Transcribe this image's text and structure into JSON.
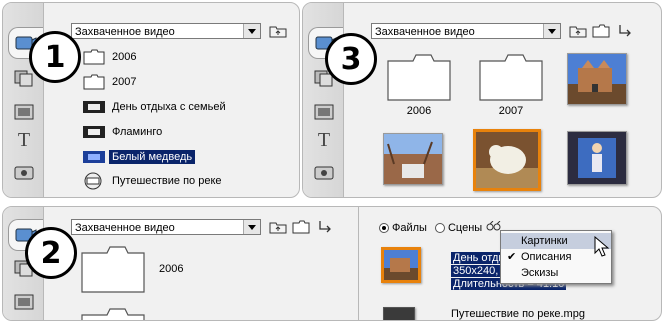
{
  "combo_label": "Захваченное видео",
  "panel1": {
    "badge": "1",
    "items": [
      {
        "label": "2006",
        "icon": "folder-icon"
      },
      {
        "label": "2007",
        "icon": "folder-icon"
      },
      {
        "label": "День отдыха с семьей",
        "icon": "film-icon"
      },
      {
        "label": "Фламинго",
        "icon": "film-icon"
      },
      {
        "label": "Белый медведь",
        "icon": "film-icon",
        "selected": true
      },
      {
        "label": "Путешествие по реке",
        "icon": "mpeg-icon"
      }
    ]
  },
  "panel3": {
    "badge": "3",
    "folders": [
      "2006",
      "2007"
    ]
  },
  "panel2": {
    "badge": "2",
    "folder": "2006",
    "radio_files": "Файлы",
    "radio_scenes": "Сцены",
    "clip_lines": [
      "День отды",
      "350x240, M",
      "Длительность = 41:10"
    ],
    "next_clip": "Путешествие по реке.mpg",
    "menu": [
      "Картинки",
      "Описания",
      "Эскизы"
    ],
    "menu_checked": "Описания"
  },
  "colors": {
    "selection": "#0a246a",
    "highlight": "#e8820c",
    "menu_hover": "#c6cede"
  }
}
